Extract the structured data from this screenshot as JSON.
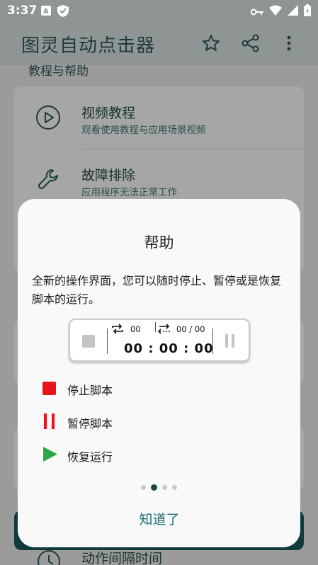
{
  "status_bar": {
    "time": "3:37"
  },
  "app_bar": {
    "title": "图灵自动点击器",
    "icons": [
      "star-icon",
      "share-icon",
      "more-vert-icon"
    ]
  },
  "background": {
    "section_header": "教程与帮助",
    "items": [
      {
        "icon": "play-circle-icon",
        "title": "视频教程",
        "subtitle": "观看使用教程与应用场景视频"
      },
      {
        "icon": "wrench-icon",
        "title": "故障排除",
        "subtitle": "应用程序无法正常工作"
      }
    ],
    "bottom_item": {
      "icon": "clock-icon",
      "title": "动作间隔时间"
    }
  },
  "dialog": {
    "title": "帮助",
    "body": "全新的操作界面，您可以随时停止、暂停或是恢复脚本的运行。",
    "controller": {
      "loop_count": "00",
      "cycle_count": "00 / 00",
      "elapsed": "00 : 00 : 00"
    },
    "legend": [
      {
        "icon": "stop-icon",
        "color": "#e8141b",
        "label": "停止脚本"
      },
      {
        "icon": "pause-icon",
        "color": "#e8141b",
        "label": "暂停脚本"
      },
      {
        "icon": "play-icon",
        "color": "#28a745",
        "label": "恢复运行"
      }
    ],
    "page_indicator": {
      "count": 4,
      "active": 2
    },
    "confirm_label": "知道了"
  },
  "colors": {
    "accent": "#1d6f73",
    "dark_teal": "#0f3b3c"
  }
}
